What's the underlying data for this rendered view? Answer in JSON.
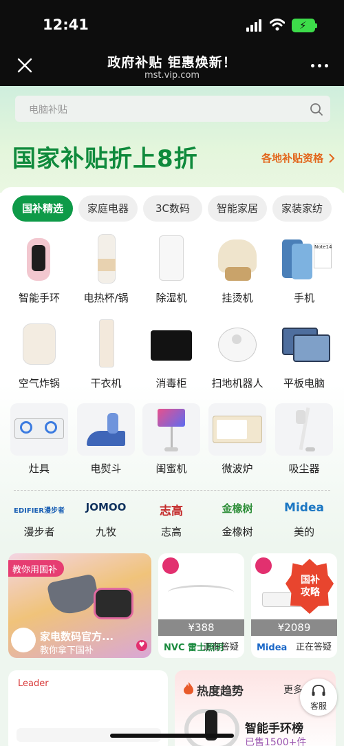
{
  "status_bar": {
    "time": "12:41"
  },
  "nav": {
    "title": "政府补贴 钜惠焕新！",
    "subtitle": "mst.vip.com"
  },
  "search": {
    "placeholder": "电脑补贴"
  },
  "banner": {
    "title": "国家补贴折上8折",
    "link": "各地补贴资格"
  },
  "tabs": [
    "国补精选",
    "家庭电器",
    "3C数码",
    "智能家居",
    "家装家纺"
  ],
  "categories": [
    [
      "智能手环",
      "电热杯/锅",
      "除湿机",
      "挂烫机",
      "手机"
    ],
    [
      "空气炸锅",
      "干衣机",
      "消毒柜",
      "扫地机器人",
      "平板电脑"
    ],
    [
      "灶具",
      "电熨斗",
      "闺蜜机",
      "微波炉",
      "吸尘器"
    ]
  ],
  "brands": [
    {
      "logo": "EDIFIER漫步者",
      "name": "漫步者"
    },
    {
      "logo": "JOMOO",
      "name": "九牧"
    },
    {
      "logo": "志高",
      "name": "志高"
    },
    {
      "logo": "金橡树",
      "name": "金橡树"
    },
    {
      "logo": "Midea",
      "name": "美的"
    }
  ],
  "promo": {
    "tag": "教你用国补",
    "shop": "家电数码官方...",
    "sub": "教你拿下国补",
    "cards": [
      {
        "price": "¥388",
        "brand": "NVC 雷士照明",
        "status": "正在答疑"
      },
      {
        "price": "¥2089",
        "brand": "Midea",
        "status": "正在答疑"
      }
    ],
    "badge": "国补攻略"
  },
  "bottom": {
    "left_brand": "Leader",
    "hot_title": "热度趋势",
    "hot_more": "更多",
    "rank_title": "智能手环榜",
    "sold": "已售1500+件"
  },
  "service_label": "客服"
}
